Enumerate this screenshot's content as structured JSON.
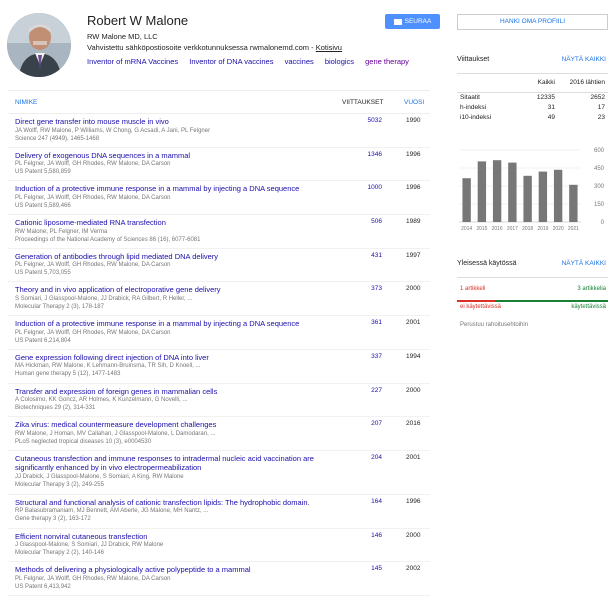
{
  "profile": {
    "name": "Robert W Malone",
    "affiliation": "RW Malone MD, LLC",
    "verified_text": "Vahvistettu sähköpostiosoite verkkotunnuksessa rwmalonemd.com - ",
    "homepage_label": "Kotisivu",
    "follow_label": "SEURAA",
    "interests": [
      "Inventor of mRNA Vaccines",
      "Inventor of DNA vaccines",
      "vaccines",
      "biologics",
      "gene therapy"
    ]
  },
  "table": {
    "col_title": "NIMIKE",
    "col_cited": "VIITTAUKSET",
    "col_year": "VUOSI",
    "rows": [
      {
        "title": "Direct gene transfer into mouse muscle in vivo",
        "authors": "JA Wolff, RW Malone, P Williams, W Chong, G Acsadi, A Jani, PL Felgner",
        "venue": "Science 247 (4949), 1465-1468",
        "cited": "5032",
        "year": "1990"
      },
      {
        "title": "Delivery of exogenous DNA sequences in a mammal",
        "authors": "PL Felgner, JA Wolff, GH Rhodes, RW Malone, DA Carson",
        "venue": "US Patent 5,580,859",
        "cited": "1346",
        "year": "1996"
      },
      {
        "title": "Induction of a protective immune response in a mammal by injecting a DNA sequence",
        "authors": "PL Felgner, JA Wolff, GH Rhodes, RW Malone, DA Carson",
        "venue": "US Patent 5,589,466",
        "cited": "1000",
        "year": "1996"
      },
      {
        "title": "Cationic liposome-mediated RNA transfection",
        "authors": "RW Malone, PL Felgner, IM Verma",
        "venue": "Proceedings of the National Academy of Sciences 86 (16), 6077-6081",
        "cited": "506",
        "year": "1989"
      },
      {
        "title": "Generation of antibodies through lipid mediated DNA delivery",
        "authors": "PL Felgner, JA Wolff, GH Rhodes, RW Malone, DA Carson",
        "venue": "US Patent 5,703,055",
        "cited": "431",
        "year": "1997"
      },
      {
        "title": "Theory and in vivo application of electroporative gene delivery",
        "authors": "S Somiari, J Glasspool-Malone, JJ Drabick, RA Gilbert, R Heller, ...",
        "venue": "Molecular Therapy 2 (3), 178-187",
        "cited": "373",
        "year": "2000"
      },
      {
        "title": "Induction of a protective immune response in a mammal by injecting a DNA sequence",
        "authors": "PL Felgner, JA Wolff, GH Rhodes, RW Malone, DA Carson",
        "venue": "US Patent 6,214,804",
        "cited": "361",
        "year": "2001"
      },
      {
        "title": "Gene expression following direct injection of DNA into liver",
        "authors": "MA Hickman, RW Malone, K Lehmann-Bruinsma, TR Sih, D Knoell, ...",
        "venue": "Human gene therapy 5 (12), 1477-1483",
        "cited": "337",
        "year": "1994"
      },
      {
        "title": "Transfer and expression of foreign genes in mammalian cells",
        "authors": "A Colosimo, KK Goncz, AR Holmes, K Kunzelmann, G Novelli, ...",
        "venue": "Biotechniques 29 (2), 314-331",
        "cited": "227",
        "year": "2000"
      },
      {
        "title": "Zika virus: medical countermeasure development challenges",
        "authors": "RW Malone, J Homan, MV Callahan, J Glasspool-Malone, L Damodaran, ...",
        "venue": "PLoS neglected tropical diseases 10 (3), e0004530",
        "cited": "207",
        "year": "2016"
      },
      {
        "title": "Cutaneous transfection and immune responses to intradermal nucleic acid vaccination are significantly enhanced by in vivo electropermeabilization",
        "authors": "JJ Drabick, J Glasspool-Malone, S Somiari, A King, RW Malone",
        "venue": "Molecular Therapy 3 (2), 249-255",
        "cited": "204",
        "year": "2001"
      },
      {
        "title": "Structural and functional analysis of cationic transfection lipids: The hydrophobic domain.",
        "authors": "RP Balasubramaniam, MJ Bennett, AM Aberle, JG Malone, MH Nantz, ...",
        "venue": "Gene therapy 3 (2), 163-172",
        "cited": "164",
        "year": "1996"
      },
      {
        "title": "Efficient nonviral cutaneous transfection",
        "authors": "J Glasspool-Malone, S Somiari, JJ Drabick, RW Malone",
        "venue": "Molecular Therapy 2 (2), 140-146",
        "cited": "146",
        "year": "2000"
      },
      {
        "title": "Methods of delivering a physiologically active polypeptide to a mammal",
        "authors": "PL Felgner, JA Wolff, GH Rhodes, RW Malone, DA Carson",
        "venue": "US Patent 6,413,942",
        "cited": "145",
        "year": "2002"
      }
    ]
  },
  "sidebar": {
    "get_profile_label": "HANKI OMA PROFIILI",
    "cited_by": {
      "title": "Viittaukset",
      "show_all": "NÄYTÄ KAIKKI",
      "col_all": "Kaikki",
      "col_since": "2016 lähtien",
      "rows": [
        {
          "label": "Sitaatit",
          "all": "12335",
          "since": "2652"
        },
        {
          "label": "h-indeksi",
          "all": "31",
          "since": "17"
        },
        {
          "label": "i10-indeksi",
          "all": "49",
          "since": "23"
        }
      ]
    },
    "public_access": {
      "title": "Yleisessä käytössä",
      "show_all": "NÄYTÄ KAIKKI",
      "left_count": "1 artikkeli",
      "right_count": "3 artikkelia",
      "left_label": "ei käytettävissä",
      "right_label": "käytettävissä",
      "funding": "Perustuu rahoitusehtoihin"
    }
  },
  "chart_data": {
    "type": "bar",
    "categories": [
      "2014",
      "2015",
      "2016",
      "2017",
      "2018",
      "2019",
      "2020",
      "2021"
    ],
    "values": [
      365,
      505,
      515,
      495,
      385,
      420,
      435,
      310
    ],
    "ylim": [
      0,
      650
    ],
    "yticks": [
      0,
      150,
      300,
      450,
      600
    ],
    "bar_color": "#777777",
    "ytick_side": "right"
  }
}
